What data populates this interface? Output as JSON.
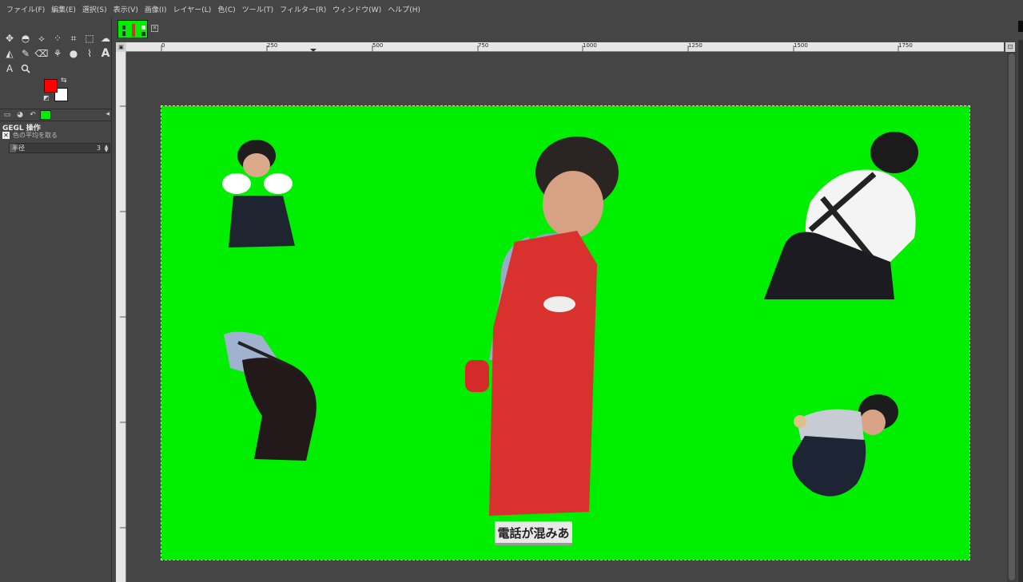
{
  "menu": [
    "ファイル(F)",
    "編集(E)",
    "選択(S)",
    "表示(V)",
    "画像(I)",
    "レイヤー(L)",
    "色(C)",
    "ツール(T)",
    "フィルター(R)",
    "ウィンドウ(W)",
    "ヘルプ(H)"
  ],
  "tools": {
    "row1": [
      "move-tool-icon",
      "ellipse-select-icon",
      "free-select-icon",
      "fuzzy-select-icon",
      "crop-icon",
      "transform-icon",
      "warp-icon"
    ],
    "row2": [
      "bucket-fill-icon",
      "paintbrush-icon",
      "eraser-icon",
      "clone-icon",
      "smudge-icon",
      "paths-icon",
      "text-tool-icon"
    ],
    "row3": [
      "measure-icon",
      "zoom-icon"
    ],
    "glyphs1": [
      "✥",
      "◓",
      "⟡",
      "⁘",
      "⌗",
      "⬚",
      "☁"
    ],
    "glyphs2": [
      "◭",
      "✎",
      "⌫",
      "⚘",
      "●",
      "⌇",
      "A"
    ],
    "glyphs3": [
      "A",
      "🔍"
    ]
  },
  "colors": {
    "foreground": "#ff0000",
    "background": "#ffffff",
    "canvas": "#00ee00"
  },
  "gegl": {
    "title": "GEGL 操作",
    "operation": "色の平均を取る",
    "radius_label": "半径",
    "radius_value": "3"
  },
  "ruler_h_labels": [
    "0",
    "250",
    "500",
    "750",
    "1000",
    "1250",
    "1500",
    "1750"
  ],
  "caption": "電話が混みあ"
}
